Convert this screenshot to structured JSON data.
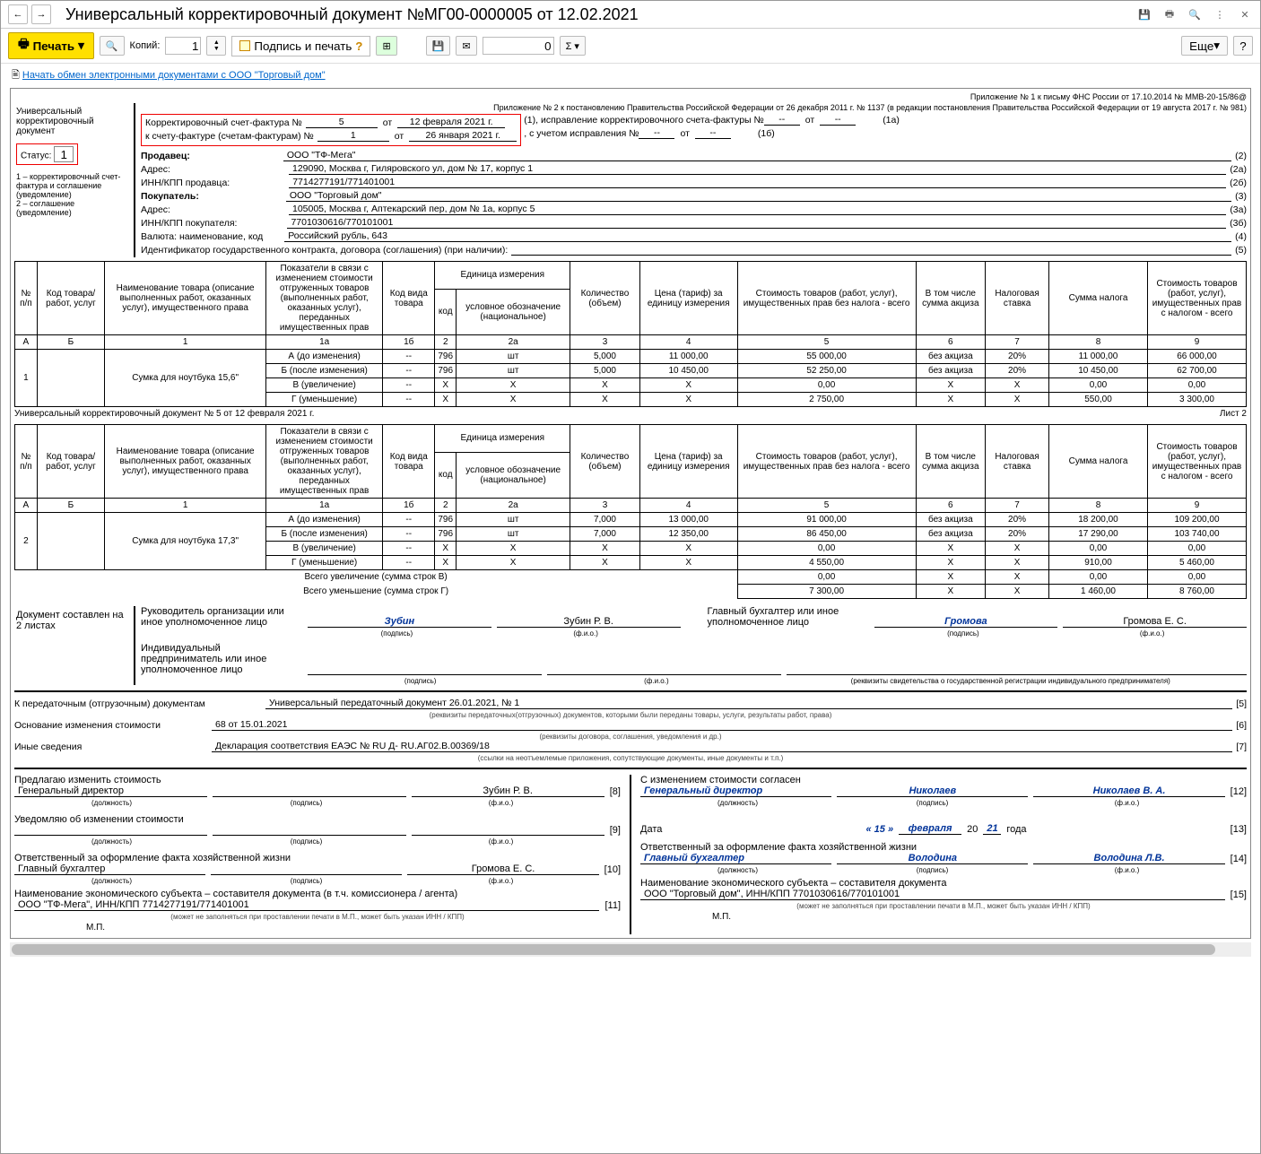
{
  "window": {
    "title": "Универсальный корректировочный документ №МГ00-0000005 от 12.02.2021"
  },
  "toolbar": {
    "print": "Печать",
    "copies_label": "Копий:",
    "copies_value": "1",
    "sign_print": "Подпись и печать",
    "amount": "0",
    "more": "Еще",
    "help": "?"
  },
  "link_bar": {
    "text": "Начать обмен электронными документами с ООО \"Торговый дом\""
  },
  "header_refs": {
    "line1": "Приложение № 1 к письму ФНС России от 17.10.2014 № ММВ-20-15/86@",
    "line2": "Приложение № 2 к постановлению Правительства Российской Федерации от 26 декабря 2011 г. № 1137 (в редакции постановления Правительства Российской Федерации от 19 августа 2017 г. № 981)"
  },
  "left_block": {
    "title": "Универсальный корректировочный документ",
    "status_label": "Статус:",
    "status_value": "1",
    "legend": "1 – корректировочный счет-фактура и соглашение (уведомление)\n2 – соглашение (уведомление)"
  },
  "corr": {
    "l1_label": "Корректировочный счет-фактура №",
    "l1_num": "5",
    "ot": "от",
    "l1_date": "12 февраля 2021 г.",
    "l1_tail_a": "(1),   исправление корректировочного счета-фактуры №",
    "l1_tail_b": "--",
    "l1_tail_c": "от",
    "l1_tail_d": "--",
    "l1_tail_code": "(1а)",
    "l2_label": "к счету-фактуре (счетам-фактурам) №",
    "l2_num": "1",
    "l2_date": "26 января 2021 г.",
    "l2_tail_a": ",   с учетом исправления №",
    "l2_tail_b": "--",
    "l2_tail_c": "от",
    "l2_tail_d": "--",
    "l2_tail_code": "(1б)"
  },
  "parties": {
    "seller_label": "Продавец:",
    "seller": "ООО \"ТФ-Мега\"",
    "seller_code": "(2)",
    "seller_addr_label": "Адрес:",
    "seller_addr": "129090, Москва г, Гиляровского ул, дом № 17, корпус 1",
    "seller_addr_code": "(2а)",
    "seller_inn_label": "ИНН/КПП продавца:",
    "seller_inn": "7714277191/771401001",
    "seller_inn_code": "(2б)",
    "buyer_label": "Покупатель:",
    "buyer": "ООО \"Торговый дом\"",
    "buyer_code": "(3)",
    "buyer_addr_label": "Адрес:",
    "buyer_addr": "105005, Москва г, Аптекарский пер, дом № 1а, корпус 5",
    "buyer_addr_code": "(3а)",
    "buyer_inn_label": "ИНН/КПП покупателя:",
    "buyer_inn": "7701030616/770101001",
    "buyer_inn_code": "(3б)",
    "currency_label": "Валюта: наименование, код",
    "currency": "Российский рубль, 643",
    "currency_code": "(4)",
    "gov_label": "Идентификатор государственного контракта, договора (соглашения) (при наличии):",
    "gov_code": "(5)"
  },
  "table_headers": {
    "npp": "№ п/п",
    "code": "Код товара/ работ, услуг",
    "name": "Наименование товара (описание выполненных работ, оказанных услуг), имущественного права",
    "indicators": "Показатели в связи с изменением стоимости отгруженных товаров (выполненных работ, оказанных услуг), переданных имущественных прав",
    "type_code": "Код вида товара",
    "unit": "Единица измерения",
    "unit_code": "код",
    "unit_name": "условное обозначение (национальное)",
    "qty": "Количество (объем)",
    "price": "Цена (тариф) за единицу измерения",
    "cost_no_tax": "Стоимость товаров (работ, услуг), имущественных прав без налога - всего",
    "excise": "В том числе сумма акциза",
    "rate": "Налоговая ставка",
    "tax_sum": "Сумма налога",
    "cost_with_tax": "Стоимость товаров (работ, услуг), имущественных прав с налогом - всего",
    "cols": [
      "А",
      "Б",
      "1",
      "1а",
      "1б",
      "2",
      "2а",
      "3",
      "4",
      "5",
      "6",
      "7",
      "8",
      "9"
    ]
  },
  "items": [
    {
      "n": "1",
      "name": "Сумка для ноутбука 15,6\"",
      "rows": [
        {
          "ind": "А (до изменения)",
          "tc": "--",
          "uc": "796",
          "un": "шт",
          "qty": "5,000",
          "price": "11 000,00",
          "cost": "55 000,00",
          "exc": "без акциза",
          "rate": "20%",
          "tax": "11 000,00",
          "total": "66 000,00"
        },
        {
          "ind": "Б (после изменения)",
          "tc": "--",
          "uc": "796",
          "un": "шт",
          "qty": "5,000",
          "price": "10 450,00",
          "cost": "52 250,00",
          "exc": "без акциза",
          "rate": "20%",
          "tax": "10 450,00",
          "total": "62 700,00"
        },
        {
          "ind": "В (увеличение)",
          "tc": "--",
          "uc": "Х",
          "un": "Х",
          "qty": "Х",
          "price": "Х",
          "cost": "0,00",
          "exc": "Х",
          "rate": "Х",
          "tax": "0,00",
          "total": "0,00"
        },
        {
          "ind": "Г (уменьшение)",
          "tc": "--",
          "uc": "Х",
          "un": "Х",
          "qty": "Х",
          "price": "Х",
          "cost": "2 750,00",
          "exc": "Х",
          "rate": "Х",
          "tax": "550,00",
          "total": "3 300,00"
        }
      ]
    }
  ],
  "sheet_line": {
    "left": "Универсальный корректировочный документ № 5 от 12 февраля 2021 г.",
    "right": "Лист 2"
  },
  "items2": [
    {
      "n": "2",
      "name": "Сумка для ноутбука 17,3\"",
      "rows": [
        {
          "ind": "А (до изменения)",
          "tc": "--",
          "uc": "796",
          "un": "шт",
          "qty": "7,000",
          "price": "13 000,00",
          "cost": "91 000,00",
          "exc": "без акциза",
          "rate": "20%",
          "tax": "18 200,00",
          "total": "109 200,00"
        },
        {
          "ind": "Б (после изменения)",
          "tc": "--",
          "uc": "796",
          "un": "шт",
          "qty": "7,000",
          "price": "12 350,00",
          "cost": "86 450,00",
          "exc": "без акциза",
          "rate": "20%",
          "tax": "17 290,00",
          "total": "103 740,00"
        },
        {
          "ind": "В (увеличение)",
          "tc": "--",
          "uc": "Х",
          "un": "Х",
          "qty": "Х",
          "price": "Х",
          "cost": "0,00",
          "exc": "Х",
          "rate": "Х",
          "tax": "0,00",
          "total": "0,00"
        },
        {
          "ind": "Г (уменьшение)",
          "tc": "--",
          "uc": "Х",
          "un": "Х",
          "qty": "Х",
          "price": "Х",
          "cost": "4 550,00",
          "exc": "Х",
          "rate": "Х",
          "tax": "910,00",
          "total": "5 460,00"
        }
      ]
    }
  ],
  "totals": {
    "inc_label": "Всего увеличение (сумма строк В)",
    "inc_cost": "0,00",
    "inc_exc": "Х",
    "inc_rate": "Х",
    "inc_tax": "0,00",
    "inc_total": "0,00",
    "dec_label": "Всего уменьшение (сумма строк Г)",
    "dec_cost": "7 300,00",
    "dec_exc": "Х",
    "dec_rate": "Х",
    "dec_tax": "1 460,00",
    "dec_total": "8 760,00"
  },
  "signers": {
    "doc_on": "Документ составлен на",
    "sheets": "2 листах",
    "head_label": "Руководитель организации или иное уполномоченное лицо",
    "head_sig": "Зубин",
    "head_name": "Зубин Р. В.",
    "acc_label": "Главный бухгалтер или иное уполномоченное лицо",
    "acc_sig": "Громова",
    "acc_name": "Громова Е. С.",
    "ip_label": "Индивидуальный предприниматель или иное уполномоченное лицо",
    "sig_cap": "(подпись)",
    "fio_cap": "(ф.и.о.)",
    "rekv_cap": "(реквизиты свидетельства о государственной  регистрации индивидуального предпринимателя)"
  },
  "transfer": {
    "trans_label": "К передаточным (отгрузочным) документам",
    "trans_val": "Универсальный передаточный документ 26.01.2021, № 1",
    "trans_code": "[5]",
    "trans_cap": "(реквизиты передаточных(отгрузочных) документов, которыми были переданы товары, услуги, результаты работ, права)",
    "basis_label": "Основание изменения стоимости",
    "basis_val": "68 от 15.01.2021",
    "basis_code": "[6]",
    "basis_cap": "(реквизиты договора, соглашения, уведомления и др.)",
    "other_label": "Иные сведения",
    "other_val": "Декларация соответствия ЕАЭС № RU Д- RU.АГ02.В.00369/18",
    "other_code": "[7]",
    "other_cap": "(ссылки на неотъемлемые приложения, сопутствующие документы, иные документы и т.п.)"
  },
  "bottom": {
    "left_t1": "Предлагаю изменить стоимость",
    "left_pos1": "Генеральный директор",
    "left_name1": "Зубин Р. В.",
    "left_code1": "[8]",
    "left_t2": "Уведомляю об изменении стоимости",
    "left_code2": "[9]",
    "left_t3": "Ответственный за оформление факта хозяйственной жизни",
    "left_pos3": "Главный бухгалтер",
    "left_name3": "Громова Е. С.",
    "left_code3": "[10]",
    "left_t4": "Наименование экономического субъекта – составителя документа (в т.ч. комиссионера / агента)",
    "left_val4": "ООО \"ТФ-Мега\", ИНН/КПП 7714277191/771401001",
    "left_code4": "[11]",
    "right_t1": "С изменением стоимости согласен",
    "right_pos1": "Генеральный директор",
    "right_sig1": "Николаев",
    "right_name1": "Николаев В. А.",
    "right_code1": "[12]",
    "right_date_label": "Дата",
    "right_date_d": "« 15 »",
    "right_date_m": "февраля",
    "right_date_y": "2021",
    "right_date_yr": "года",
    "right_code2": "[13]",
    "right_t3": "Ответственный за оформление факта хозяйственной жизни",
    "right_pos3": "Главный бухгалтер",
    "right_sig3": "Володина",
    "right_name3": "Володина Л.В.",
    "right_code3": "[14]",
    "right_t4": "Наименование экономического субъекта – составителя документа",
    "right_val4": "ООО \"Торговый дом\", ИНН/КПП 7701030616/770101001",
    "right_code4": "[15]",
    "pos_cap": "(должность)",
    "mp_note": "(может не заполняться при проставлении печати в М.П., может быть указан ИНН / КПП)",
    "mp": "М.П."
  }
}
